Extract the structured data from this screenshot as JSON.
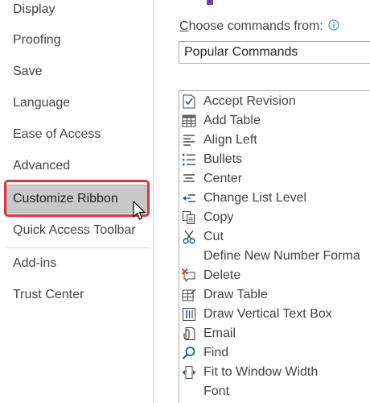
{
  "sidebar": {
    "items": [
      {
        "label": "Display"
      },
      {
        "label": "Proofing"
      },
      {
        "label": "Save"
      },
      {
        "label": "Language"
      },
      {
        "label": "Ease of Access"
      },
      {
        "label": "Advanced"
      },
      {
        "label": "Customize Ribbon",
        "selected": true
      },
      {
        "label": "Quick Access Toolbar"
      },
      {
        "label": "Add-ins"
      },
      {
        "label": "Trust Center"
      }
    ]
  },
  "main": {
    "choose_label_prefix": "C",
    "choose_label_rest": "hoose commands from:",
    "dropdown_value": "Popular Commands",
    "commands": [
      {
        "label": "Accept Revision",
        "icon": "accept-revision-icon"
      },
      {
        "label": "Add Table",
        "icon": "table-icon"
      },
      {
        "label": "Align Left",
        "icon": "align-left-icon"
      },
      {
        "label": "Bullets",
        "icon": "bullets-icon"
      },
      {
        "label": "Center",
        "icon": "align-center-icon"
      },
      {
        "label": "Change List Level",
        "icon": "change-list-level-icon"
      },
      {
        "label": "Copy",
        "icon": "copy-icon"
      },
      {
        "label": "Cut",
        "icon": "scissors-icon"
      },
      {
        "label": "Define New Number Forma",
        "icon": ""
      },
      {
        "label": "Delete",
        "icon": "delete-comment-icon"
      },
      {
        "label": "Draw Table",
        "icon": "draw-table-icon"
      },
      {
        "label": "Draw Vertical Text Box",
        "icon": "vertical-text-box-icon"
      },
      {
        "label": "Email",
        "icon": "email-attach-icon"
      },
      {
        "label": "Find",
        "icon": "magnifier-icon"
      },
      {
        "label": "Fit to Window Width",
        "icon": "fit-width-icon"
      },
      {
        "label": "Font",
        "icon": ""
      }
    ]
  },
  "colors": {
    "highlight_ring": "#e0343d",
    "selected_bg": "#c8c8c8",
    "info_icon": "#2b7cd3",
    "cut_icon": "#2b5797",
    "delete_icon": "#d13438"
  }
}
